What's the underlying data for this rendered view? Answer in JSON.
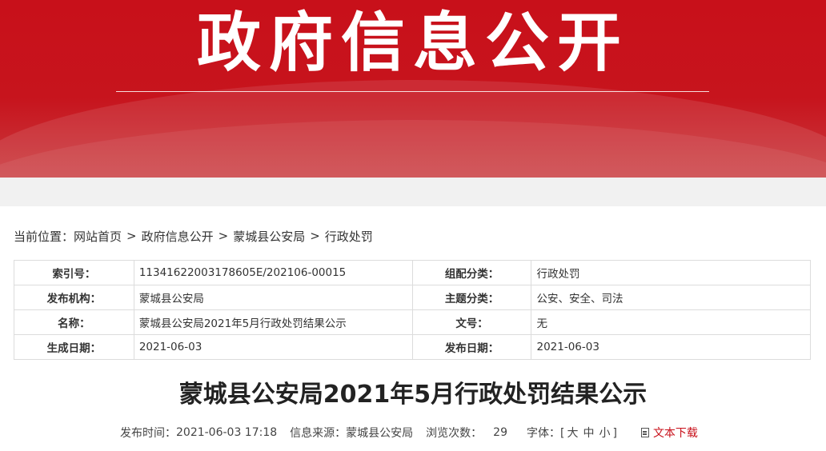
{
  "banner": {
    "title": "政府信息公开"
  },
  "breadcrumb": {
    "prefix": "当前位置：",
    "items": [
      "网站首页",
      "政府信息公开",
      "蒙城县公安局",
      "行政处罚"
    ],
    "separator": ">"
  },
  "meta": {
    "rows": [
      {
        "k1": "索引号：",
        "v1": "11341622003178605E/202106-00015",
        "k2": "组配分类：",
        "v2": "行政处罚"
      },
      {
        "k1": "发布机构：",
        "v1": "蒙城县公安局",
        "k2": "主题分类：",
        "v2": "公安、安全、司法"
      },
      {
        "k1": "名称：",
        "v1": "蒙城县公安局2021年5月行政处罚结果公示",
        "k2": "文号：",
        "v2": "无"
      },
      {
        "k1": "生成日期：",
        "v1": "2021-06-03",
        "k2": "发布日期：",
        "v2": "2021-06-03"
      }
    ]
  },
  "article": {
    "title": "蒙城县公安局2021年5月行政处罚结果公示",
    "publish_time_label": "发布时间：",
    "publish_time": "2021-06-03 17:18",
    "source_label": "信息来源：",
    "source": "蒙城县公安局",
    "views_label": "浏览次数：",
    "views": "29",
    "font_size_label": "字体：",
    "font_open": "[",
    "font_sizes": [
      "大",
      "中",
      "小"
    ],
    "font_close": "]",
    "download_label": "文本下载"
  },
  "colors": {
    "brand_red": "#c8101a",
    "grey_band": "#f1f1f1",
    "table_border": "#dcdcdc"
  }
}
